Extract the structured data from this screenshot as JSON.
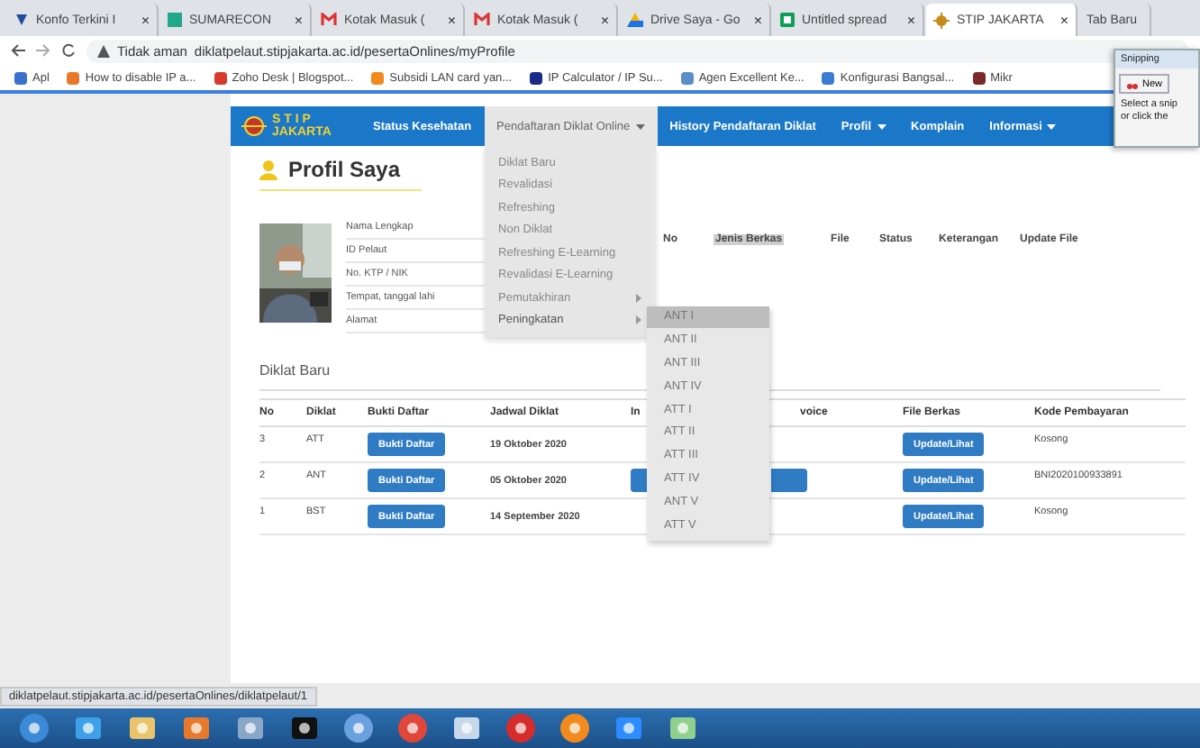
{
  "browser": {
    "tabs": [
      {
        "title": "Konfo Terkini I",
        "close": "×",
        "selected": false
      },
      {
        "title": "SUMARECON",
        "close": "×",
        "selected": false
      },
      {
        "title": "Kotak Masuk (",
        "close": "×",
        "selected": false
      },
      {
        "title": "Kotak Masuk (",
        "close": "×",
        "selected": false
      },
      {
        "title": "Drive Saya - Go",
        "close": "×",
        "selected": false
      },
      {
        "title": "Untitled spread",
        "close": "×",
        "selected": false
      },
      {
        "title": "STIP JAKARTA",
        "close": "×",
        "selected": true
      },
      {
        "title": "Tab Baru",
        "selected": false
      }
    ],
    "security": "Tidak aman",
    "url": "diklatpelaut.stipjakarta.ac.id/pesertaOnlines/myProfile",
    "bookmarks": [
      {
        "label": "Apl",
        "color": "#3b6fd0"
      },
      {
        "label": "How to disable IP a...",
        "color": "#e8792b"
      },
      {
        "label": "Zoho Desk | Blogspot...",
        "color": "#d93a2b"
      },
      {
        "label": "Subsidi LAN card yan...",
        "color": "#f08a1c"
      },
      {
        "label": "IP Calculator / IP Su...",
        "color": "#1a2a8a"
      },
      {
        "label": "Agen Excellent Ke...",
        "color": "#5a8fc8"
      },
      {
        "label": "Konfigurasi Bangsal...",
        "color": "#3c7bd4"
      },
      {
        "label": "Mikr",
        "color": "#7a2a2a"
      }
    ]
  },
  "snipping": {
    "title": "Snipping",
    "button": "New",
    "hint": [
      "Select a snip",
      "or click the"
    ]
  },
  "site": {
    "logo": [
      "S T I P",
      "JAKARTA"
    ],
    "nav": [
      {
        "label": "Status Kesehatan",
        "caret": false,
        "selected": false
      },
      {
        "label": "Pendaftaran Diklat Online",
        "caret": true,
        "selected": true
      },
      {
        "label": "History Pendaftaran Diklat",
        "caret": false,
        "selected": false
      },
      {
        "label": "Profil",
        "caret": true,
        "selected": false
      },
      {
        "label": "Komplain",
        "caret": false,
        "selected": false
      },
      {
        "label": "Informasi",
        "caret": true,
        "selected": false
      }
    ],
    "dropdown": [
      {
        "label": "Diklat Baru",
        "submenu": false,
        "selected": false
      },
      {
        "label": "Revalidasi",
        "submenu": false,
        "selected": false
      },
      {
        "label": "Refreshing",
        "submenu": false,
        "selected": false
      },
      {
        "label": "Non Diklat",
        "submenu": false,
        "selected": false
      },
      {
        "label": "Refreshing E-Learning",
        "submenu": false,
        "selected": false
      },
      {
        "label": "Revalidasi E-Learning",
        "submenu": false,
        "selected": false
      },
      {
        "label": "Pemutakhiran",
        "submenu": true,
        "selected": false
      },
      {
        "label": "Peningkatan",
        "submenu": true,
        "selected": true
      }
    ],
    "submenu": [
      {
        "label": "ANT I",
        "selected": true
      },
      {
        "label": "ANT II",
        "selected": false
      },
      {
        "label": "ANT III",
        "selected": false
      },
      {
        "label": "ANT IV",
        "selected": false
      },
      {
        "label": "ATT I",
        "selected": false
      },
      {
        "label": "ATT II",
        "selected": false
      },
      {
        "label": "ATT III",
        "selected": false
      },
      {
        "label": "ATT IV",
        "selected": false
      },
      {
        "label": "ANT V",
        "selected": false
      },
      {
        "label": "ATT V",
        "selected": false
      }
    ],
    "profile": {
      "title": "Profil Saya",
      "fields": [
        "Nama Lengkap",
        "ID Pelaut",
        "No. KTP / NIK",
        "Tempat, tanggal lahi",
        "Alamat"
      ],
      "files_columns": [
        "No",
        "Jenis Berkas",
        "File",
        "Status",
        "Keterangan",
        "Update File"
      ]
    },
    "diklat": {
      "title": "Diklat Baru",
      "columns": [
        "No",
        "Diklat",
        "Bukti Daftar",
        "Jadwal Diklat",
        "In",
        "voice",
        "File Berkas",
        "Kode Pembayaran"
      ],
      "rows": [
        {
          "no": "3",
          "diklat": "ATT",
          "proof": "Bukti Daftar",
          "date": "19 Oktober 2020",
          "invoice_button": false,
          "file": "Update/Lihat",
          "code": "Kosong"
        },
        {
          "no": "2",
          "diklat": "ANT",
          "proof": "Bukti Daftar",
          "date": "05 Oktober 2020",
          "invoice_button": true,
          "file": "Update/Lihat",
          "code": "BNI2020100933891"
        },
        {
          "no": "1",
          "diklat": "BST",
          "proof": "Bukti Daftar",
          "date": "14 September 2020",
          "invoice_button": false,
          "file": "Update/Lihat",
          "code": "Kosong"
        }
      ]
    }
  },
  "status_url": "diklatpelaut.stipjakarta.ac.id/pesertaOnlines/diklatpelaut/1"
}
